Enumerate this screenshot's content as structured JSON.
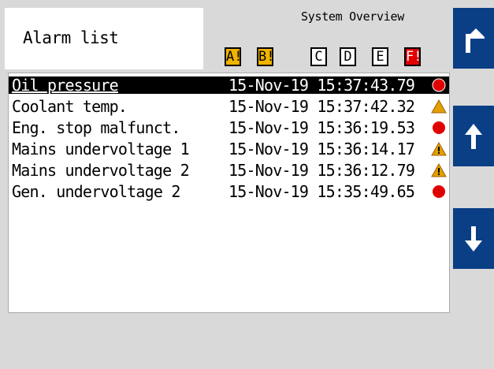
{
  "header": {
    "title": "Alarm list",
    "system_overview": "System Overview"
  },
  "badges": [
    {
      "label": "A!",
      "style": "amber"
    },
    {
      "label": "B!",
      "style": "amber"
    },
    {
      "label": "C",
      "style": "white"
    },
    {
      "label": "D",
      "style": "white"
    },
    {
      "label": "E",
      "style": "white"
    },
    {
      "label": "F!",
      "style": "red"
    }
  ],
  "alarms": [
    {
      "name": "Oil pressure",
      "time": "15-Nov-19 15:37:43.79",
      "severity": "shutdown"
    },
    {
      "name": "Coolant temp.",
      "time": "15-Nov-19 15:37:42.32",
      "severity": "warning"
    },
    {
      "name": "Eng. stop malfunct.",
      "time": "15-Nov-19 15:36:19.53",
      "severity": "shutdown"
    },
    {
      "name": "Mains undervoltage 1",
      "time": "15-Nov-19 15:36:14.17",
      "severity": "warning"
    },
    {
      "name": "Mains undervoltage 2",
      "time": "15-Nov-19 15:36:12.79",
      "severity": "warning"
    },
    {
      "name": "Gen. undervoltage 2",
      "time": "15-Nov-19 15:35:49.65",
      "severity": "shutdown"
    }
  ],
  "selected_index": 0,
  "nav": {
    "icons": [
      "return-arrow-icon",
      "arrow-up-icon",
      "arrow-down-icon"
    ]
  },
  "colors": {
    "accent": "#0a3f86",
    "shutdown": "#e00000",
    "warning": "#e0a000"
  }
}
